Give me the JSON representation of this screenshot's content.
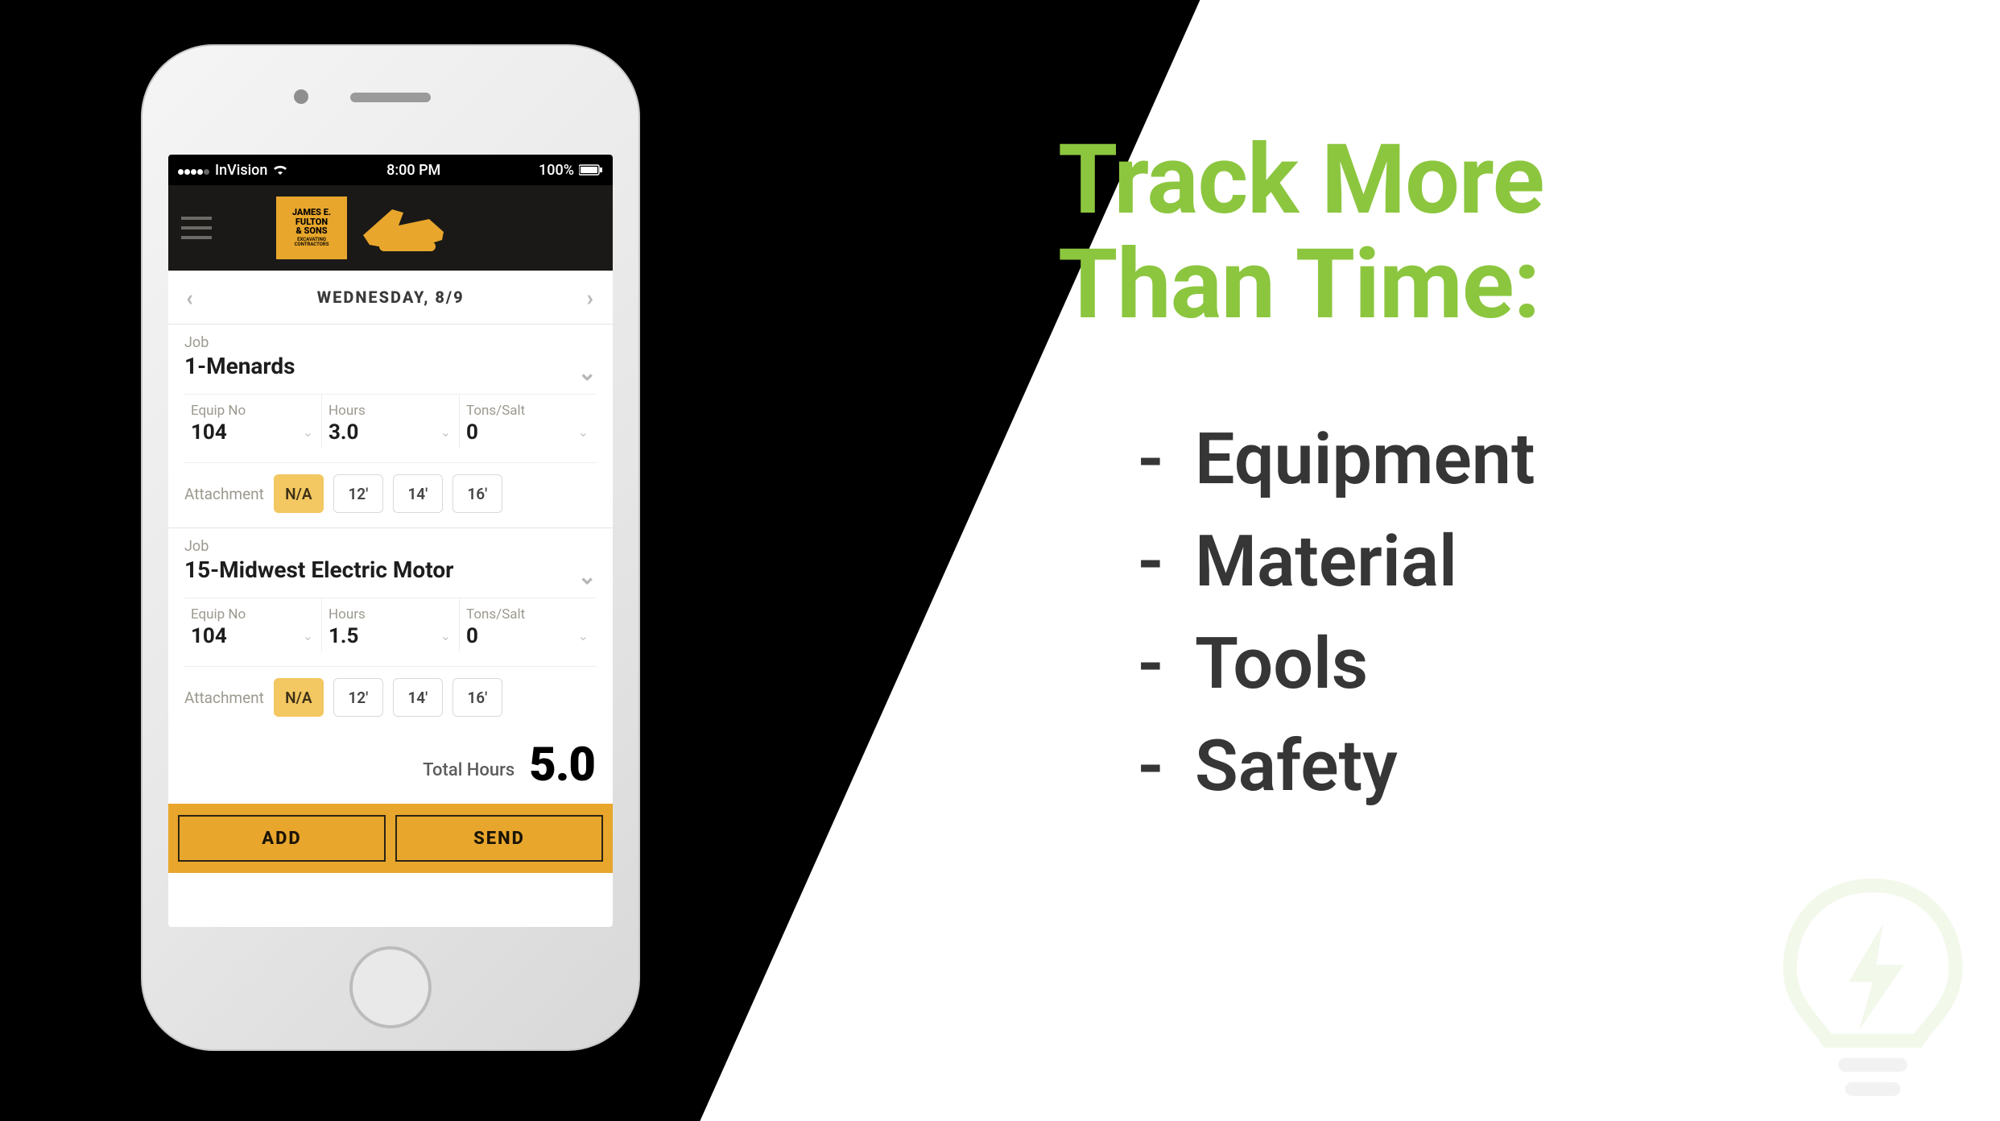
{
  "slide": {
    "heading_line1": "Track More",
    "heading_line2": "Than Time:",
    "bullets": [
      "Equipment",
      "Material",
      "Tools",
      "Safety"
    ]
  },
  "phone": {
    "status": {
      "carrier": "InVision",
      "time": "8:00 PM",
      "battery": "100%"
    },
    "brand": {
      "line1": "JAMES E.",
      "line2": "FULTON",
      "line3": "& SONS",
      "line4": "EXCAVATING",
      "line5": "CONTRACTORS"
    },
    "date_label": "WEDNESDAY, 8/9",
    "labels": {
      "job": "Job",
      "equip": "Equip No",
      "hours": "Hours",
      "tons": "Tons/Salt",
      "attachment": "Attachment",
      "total_hours": "Total Hours"
    },
    "jobs": [
      {
        "name": "1-Menards",
        "equip": "104",
        "hours": "3.0",
        "tons": "0",
        "attachment_options": [
          "N/A",
          "12'",
          "14'",
          "16'"
        ],
        "attachment_selected": 0
      },
      {
        "name": "15-Midwest Electric Motor",
        "equip": "104",
        "hours": "1.5",
        "tons": "0",
        "attachment_options": [
          "N/A",
          "12'",
          "14'",
          "16'"
        ],
        "attachment_selected": 0
      }
    ],
    "total_hours": "5.0",
    "buttons": {
      "add": "ADD",
      "send": "SEND"
    }
  }
}
